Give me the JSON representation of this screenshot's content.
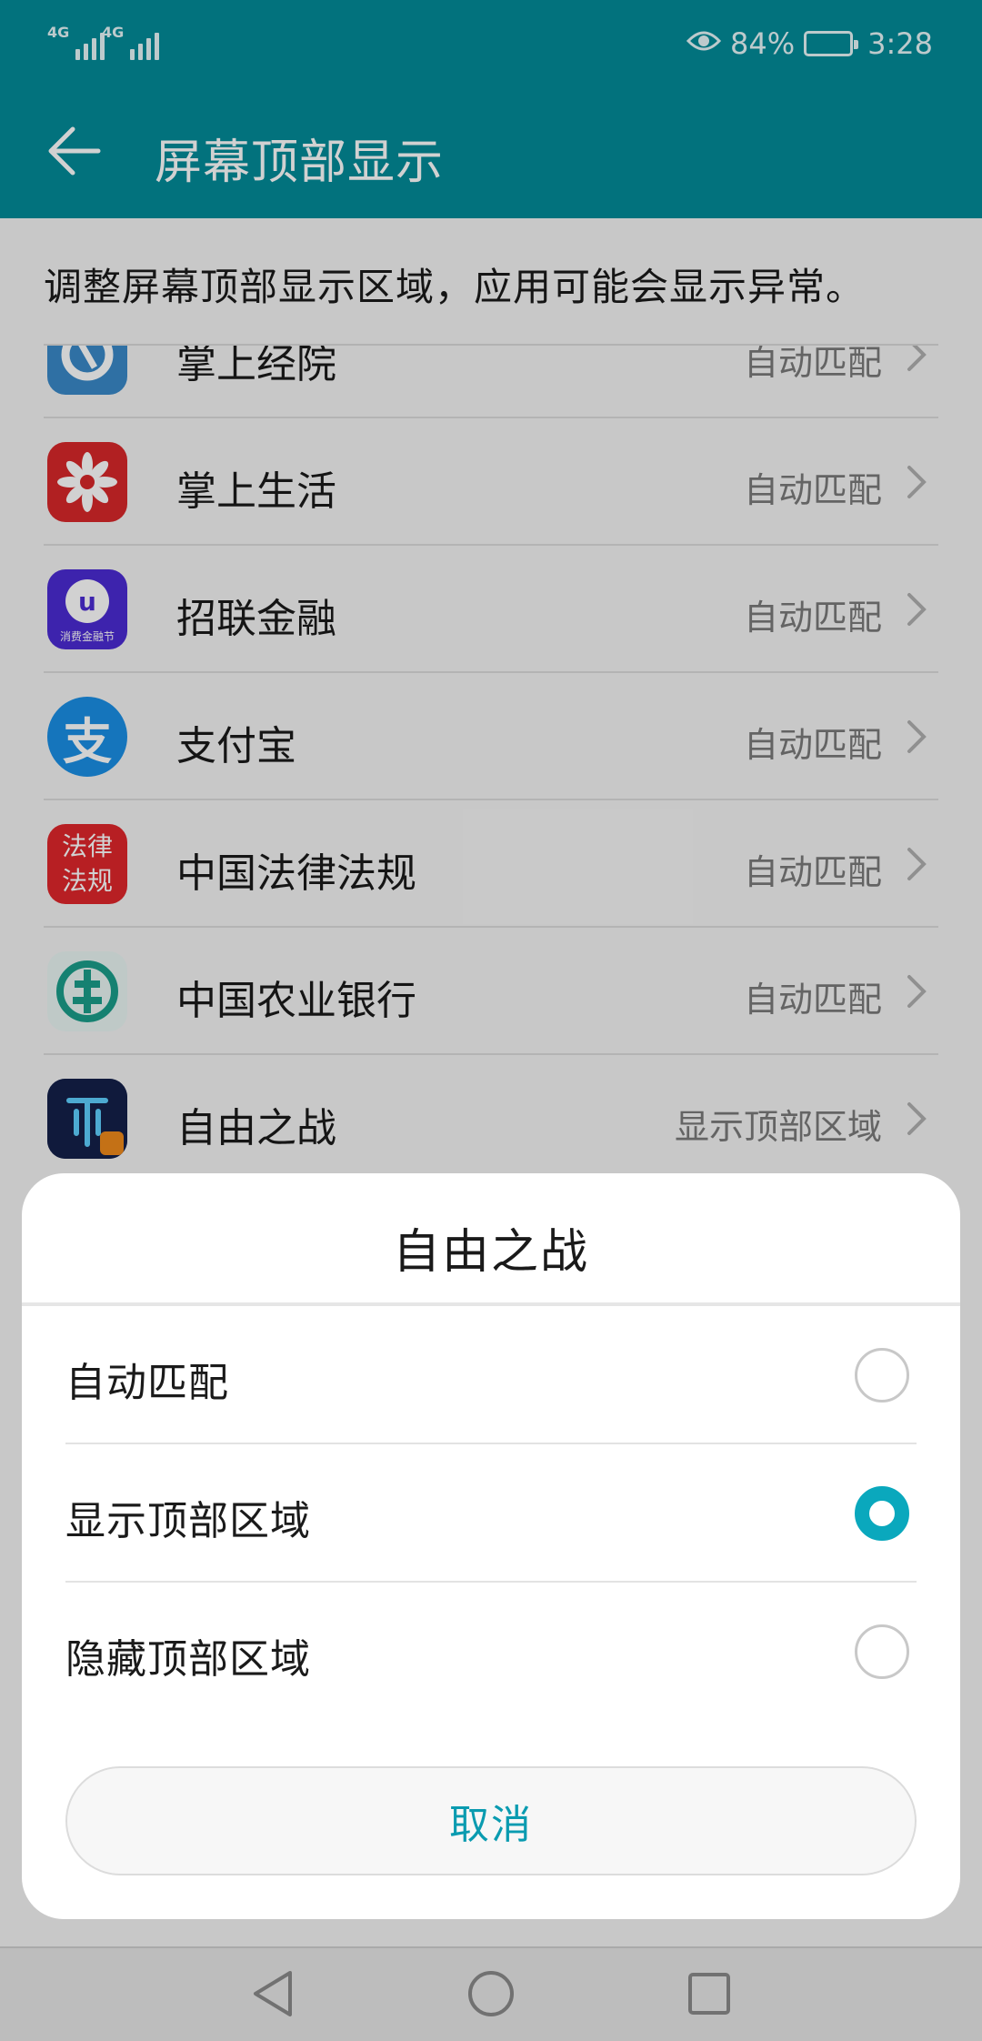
{
  "status_bar": {
    "network_1": "4G",
    "network_2": "4G",
    "battery_percent": "84%",
    "battery_level": 0.84,
    "time": "3:28",
    "icons": [
      "eye-icon",
      "battery-icon",
      "signal-icon"
    ]
  },
  "header": {
    "title": "屏幕顶部显示",
    "back_icon": "arrow-left-icon"
  },
  "description": "调整屏幕顶部显示区域，应用可能会显示异常。",
  "apps": [
    {
      "name": "掌上经院",
      "mode": "自动匹配",
      "icon": "app-icon-zhangshangjingyuan",
      "color": "#3a89c9"
    },
    {
      "name": "掌上生活",
      "mode": "自动匹配",
      "icon": "app-icon-zhangshangshenghuo",
      "color": "#d8282a"
    },
    {
      "name": "招联金融",
      "mode": "自动匹配",
      "icon": "app-icon-zhaolianjinrong",
      "color": "#4b2bd3",
      "badge": "消费金融节"
    },
    {
      "name": "支付宝",
      "mode": "自动匹配",
      "icon": "app-icon-alipay",
      "color": "#1a8fe6",
      "glyph": "支"
    },
    {
      "name": "中国法律法规",
      "mode": "自动匹配",
      "icon": "app-icon-falvfagui",
      "color": "#e0262b",
      "glyph_lines": [
        "法律",
        "法规"
      ]
    },
    {
      "name": "中国农业银行",
      "mode": "自动匹配",
      "icon": "app-icon-abc-bank",
      "color": "#1a9e8a"
    },
    {
      "name": "自由之战",
      "mode": "显示顶部区域",
      "icon": "app-icon-ziyouzhizhan",
      "color": "#1b2a5c"
    }
  ],
  "dialog": {
    "title": "自由之战",
    "options": [
      {
        "label": "自动匹配",
        "selected": false
      },
      {
        "label": "显示顶部区域",
        "selected": true
      },
      {
        "label": "隐藏顶部区域",
        "selected": false
      }
    ],
    "cancel_label": "取消",
    "accent_color": "#0aa8bd"
  },
  "nav_bar": {
    "icons": [
      "back-triangle-icon",
      "home-circle-icon",
      "recents-square-icon"
    ]
  },
  "colors": {
    "header_bg": "#038b99",
    "accent": "#0aa8bd"
  }
}
